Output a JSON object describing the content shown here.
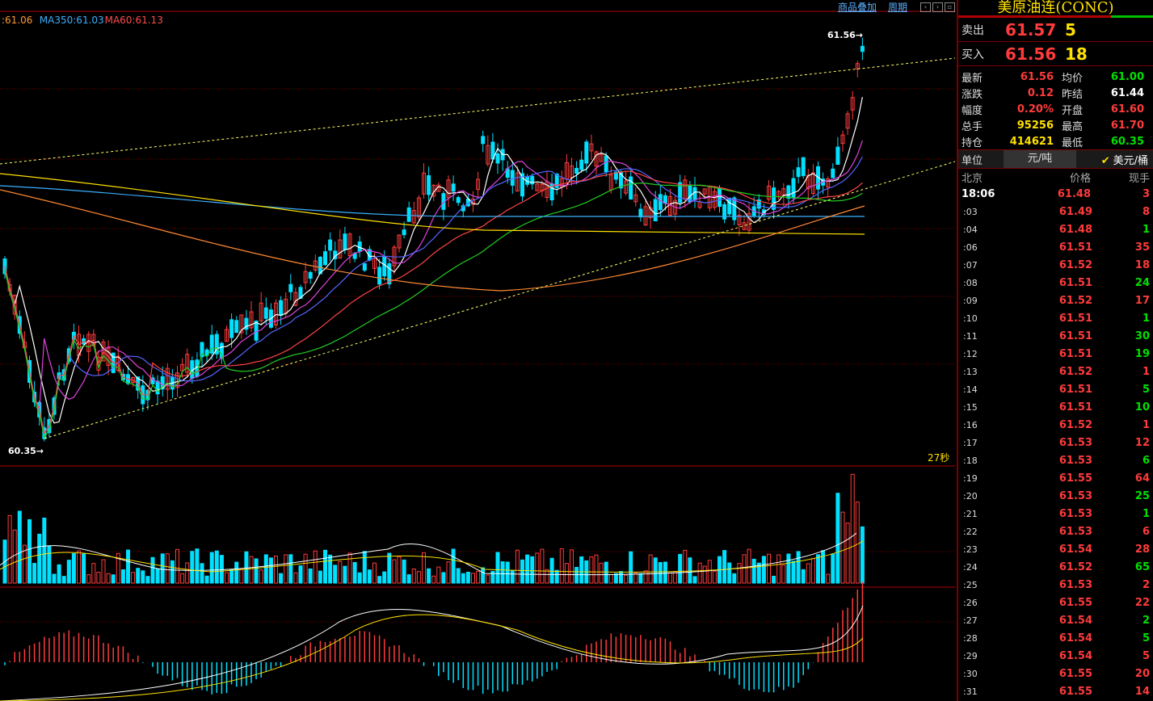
{
  "chart": {
    "ma_legend": [
      {
        "label": ":61.06",
        "color": "#ff9933"
      },
      {
        "label": "MA350:61.03",
        "color": "#3ab0ff"
      },
      {
        "label": "MA60:61.13",
        "color": "#ff4d4d"
      }
    ],
    "top_links": {
      "overlay": "商品叠加",
      "period": "周期"
    },
    "high_marker": "61.56",
    "low_marker": "60.35",
    "timer": "27秒",
    "colors": {
      "up": "#ff3b3b",
      "down": "#00e0ff",
      "grid": "#7a0000",
      "trend": "#ffff66"
    }
  },
  "side": {
    "title": "美原油连(CONC)",
    "ask": {
      "label": "卖出",
      "price": "61.57",
      "volume": "5"
    },
    "bid": {
      "label": "买入",
      "price": "61.56",
      "volume": "18"
    },
    "stats": [
      {
        "k": "最新",
        "v": "61.56",
        "vc": "#ff3b3b",
        "k2": "均价",
        "v2": "61.00",
        "v2c": "#00e000"
      },
      {
        "k": "涨跌",
        "v": "0.12",
        "vc": "#ff3b3b",
        "k2": "昨结",
        "v2": "61.44",
        "v2c": "#ffffff"
      },
      {
        "k": "幅度",
        "v": "0.20%",
        "vc": "#ff3b3b",
        "k2": "开盘",
        "v2": "61.60",
        "v2c": "#ff3b3b"
      },
      {
        "k": "总手",
        "v": "95256",
        "vc": "#ffe000",
        "k2": "最高",
        "v2": "61.70",
        "v2c": "#ff3b3b"
      },
      {
        "k": "持仓",
        "v": "414621",
        "vc": "#ffe000",
        "k2": "最低",
        "v2": "60.35",
        "v2c": "#00e000"
      }
    ],
    "unit": {
      "label": "单位",
      "opt1": "元/吨",
      "opt2": "美元/桶"
    },
    "table_head": {
      "time": "北京",
      "price": "价格",
      "vol": "现手"
    },
    "ticks": [
      {
        "t": "18:06",
        "p": "61.48",
        "v": "3",
        "c": "#ff3b3b"
      },
      {
        "t": ":03",
        "p": "61.49",
        "v": "8",
        "c": "#ff3b3b"
      },
      {
        "t": ":04",
        "p": "61.48",
        "v": "1",
        "c": "#00e000"
      },
      {
        "t": ":06",
        "p": "61.51",
        "v": "35",
        "c": "#ff3b3b"
      },
      {
        "t": ":07",
        "p": "61.52",
        "v": "18",
        "c": "#ff3b3b"
      },
      {
        "t": ":08",
        "p": "61.51",
        "v": "24",
        "c": "#00e000"
      },
      {
        "t": ":09",
        "p": "61.52",
        "v": "17",
        "c": "#ff3b3b"
      },
      {
        "t": ":10",
        "p": "61.51",
        "v": "1",
        "c": "#00e000"
      },
      {
        "t": ":11",
        "p": "61.51",
        "v": "30",
        "c": "#00e000"
      },
      {
        "t": ":12",
        "p": "61.51",
        "v": "19",
        "c": "#00e000"
      },
      {
        "t": ":13",
        "p": "61.52",
        "v": "1",
        "c": "#ff3b3b"
      },
      {
        "t": ":14",
        "p": "61.51",
        "v": "5",
        "c": "#00e000"
      },
      {
        "t": ":15",
        "p": "61.51",
        "v": "10",
        "c": "#00e000"
      },
      {
        "t": ":16",
        "p": "61.52",
        "v": "1",
        "c": "#ff3b3b"
      },
      {
        "t": ":17",
        "p": "61.53",
        "v": "12",
        "c": "#ff3b3b"
      },
      {
        "t": ":18",
        "p": "61.53",
        "v": "6",
        "c": "#00e000"
      },
      {
        "t": ":19",
        "p": "61.55",
        "v": "64",
        "c": "#ff3b3b"
      },
      {
        "t": ":20",
        "p": "61.53",
        "v": "25",
        "c": "#00e000"
      },
      {
        "t": ":21",
        "p": "61.53",
        "v": "1",
        "c": "#00e000"
      },
      {
        "t": ":22",
        "p": "61.53",
        "v": "6",
        "c": "#ff3b3b"
      },
      {
        "t": ":23",
        "p": "61.54",
        "v": "28",
        "c": "#ff3b3b"
      },
      {
        "t": ":24",
        "p": "61.52",
        "v": "65",
        "c": "#00e000"
      },
      {
        "t": ":25",
        "p": "61.53",
        "v": "2",
        "c": "#ff3b3b"
      },
      {
        "t": ":26",
        "p": "61.55",
        "v": "22",
        "c": "#ff3b3b"
      },
      {
        "t": ":27",
        "p": "61.54",
        "v": "2",
        "c": "#00e000"
      },
      {
        "t": ":28",
        "p": "61.54",
        "v": "5",
        "c": "#00e000"
      },
      {
        "t": ":29",
        "p": "61.54",
        "v": "5",
        "c": "#ff3b3b"
      },
      {
        "t": ":30",
        "p": "61.55",
        "v": "20",
        "c": "#ff3b3b"
      },
      {
        "t": ":31",
        "p": "61.55",
        "v": "14",
        "c": "#ff3b3b"
      }
    ]
  }
}
